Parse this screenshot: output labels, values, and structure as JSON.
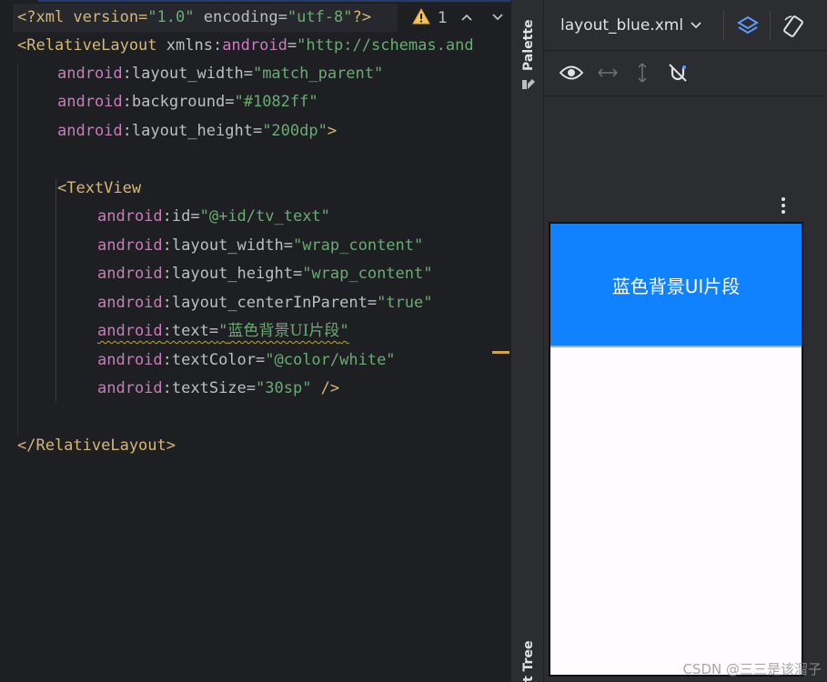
{
  "editor": {
    "line1": {
      "decl": "<?xml version=",
      "v1": "\"1.0\"",
      "enc": " encoding=",
      "v2": "\"utf-8\"",
      "end": "?>"
    },
    "line2": {
      "tag": "<RelativeLayout",
      "attr": " xmlns:",
      "ns": "android",
      "eq": "=",
      "val": "\"http://schemas.and"
    },
    "line3": {
      "ns": "android",
      "attr": ":layout_width=",
      "val": "\"match_parent\""
    },
    "line4": {
      "ns": "android",
      "attr": ":background=",
      "val": "\"#1082ff\""
    },
    "line5": {
      "ns": "android",
      "attr": ":layout_height=",
      "val": "\"200dp\"",
      "end": ">"
    },
    "line7": {
      "tag": "<TextView"
    },
    "line8": {
      "ns": "android",
      "attr": ":id=",
      "val": "\"@+id/tv_text\""
    },
    "line9": {
      "ns": "android",
      "attr": ":layout_width=",
      "val": "\"wrap_content\""
    },
    "line10": {
      "ns": "android",
      "attr": ":layout_height=",
      "val": "\"wrap_content\""
    },
    "line11": {
      "ns": "android",
      "attr": ":layout_centerInParent=",
      "val": "\"true\""
    },
    "line12": {
      "ns": "android",
      "attr": ":text=",
      "q1": "\"",
      "val": "蓝色背景UI片段",
      "q2": "\""
    },
    "line13": {
      "ns": "android",
      "attr": ":textColor=",
      "val": "\"@color/white\""
    },
    "line14": {
      "ns": "android",
      "attr": ":textSize=",
      "val": "\"30sp\"",
      "end": " />"
    },
    "line16": {
      "tag": "</RelativeLayout>"
    }
  },
  "inspection": {
    "warning_count": "1",
    "icon": "warning-icon",
    "up": "˄",
    "down": "˅"
  },
  "side_tabs": {
    "palette": "Palette",
    "component_tree": "nt Tree"
  },
  "design": {
    "file_name": "layout_blue.xml",
    "icons": [
      "design-surface-icon",
      "orientation-icon",
      "eye-icon",
      "horizontal-arrows-icon",
      "vertical-arrows-icon",
      "magnet-off-icon",
      "more-icon"
    ],
    "preview_text": "蓝色背景UI片段",
    "preview_bg": "#1082ff"
  },
  "watermark": "CSDN @三三是该溜子"
}
